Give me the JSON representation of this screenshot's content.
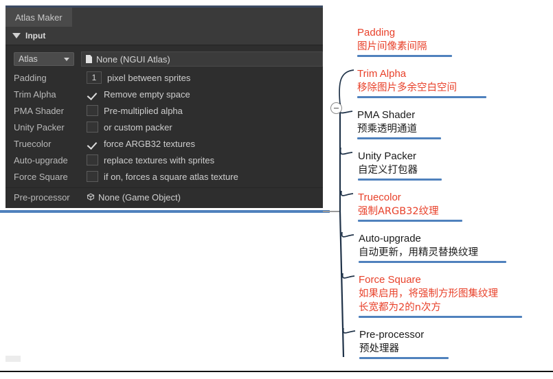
{
  "panel": {
    "tab_label": "Atlas Maker",
    "section_title": "Input",
    "section_icon": "triangle-down-icon",
    "atlas_row": {
      "dropdown_label": "Atlas",
      "dropdown_icon": "chevron-down-icon",
      "object_icon": "document-icon",
      "object_value": "None (NGUI Atlas)"
    },
    "rows": [
      {
        "label": "Padding",
        "control": "int",
        "value": "1",
        "text": "pixel between sprites"
      },
      {
        "label": "Trim Alpha",
        "control": "checkbox",
        "checked": true,
        "text": "Remove empty space"
      },
      {
        "label": "PMA Shader",
        "control": "checkbox",
        "checked": false,
        "text": "Pre-multiplied alpha"
      },
      {
        "label": "Unity Packer",
        "control": "checkbox",
        "checked": false,
        "text": "or custom packer"
      },
      {
        "label": "Truecolor",
        "control": "checkbox",
        "checked": true,
        "text": "force ARGB32 textures"
      },
      {
        "label": "Auto-upgrade",
        "control": "checkbox",
        "checked": false,
        "text": "replace textures with sprites"
      },
      {
        "label": "Force Square",
        "control": "checkbox",
        "checked": false,
        "text": "if on, forces a square atlas texture"
      }
    ],
    "preprocessor_row": {
      "label": "Pre-processor",
      "object_icon": "gameobject-cube-icon",
      "object_value": "None (Game Object)"
    }
  },
  "mindmap": {
    "root_toggle_icon": "collapse-minus-icon",
    "nodes": [
      {
        "title": "Padding",
        "lines": [
          "图片间像素间隔"
        ],
        "color": "red",
        "underline_color": "#4f81bd",
        "underline_width": 138
      },
      {
        "title": "Trim Alpha",
        "lines": [
          "移除图片多余空白空间"
        ],
        "color": "red",
        "underline_color": "#4f81bd",
        "underline_width": 188
      },
      {
        "title": "PMA Shader",
        "lines": [
          "预乘透明通道"
        ],
        "color": "black",
        "underline_color": "#4f81bd",
        "underline_width": 122
      },
      {
        "title": "Unity Packer",
        "lines": [
          "自定义打包器"
        ],
        "color": "black",
        "underline_color": "#4f81bd",
        "underline_width": 122
      },
      {
        "title": "Truecolor",
        "lines": [
          "强制ARGB32纹理"
        ],
        "color": "red",
        "underline_color": "#4f81bd",
        "underline_width": 152
      },
      {
        "title": "Auto-upgrade",
        "lines": [
          "自动更新，用精灵替换纹理"
        ],
        "color": "black",
        "underline_color": "#4f81bd",
        "underline_width": 215
      },
      {
        "title": "Force Square",
        "lines": [
          "如果启用，将强制方形图集纹理",
          "长宽都为2的n次方"
        ],
        "color": "red",
        "underline_color": "#4f81bd",
        "underline_width": 238
      },
      {
        "title": "Pre-processor",
        "lines": [
          "预处理器"
        ],
        "color": "black",
        "underline_color": "#4f81bd",
        "underline_width": 130
      }
    ]
  },
  "colors": {
    "accent_blue": "#4f81bd",
    "annotation_red": "#e8412a",
    "annotation_black": "#1a1a1a",
    "panel_background": "#2e2e2e"
  }
}
